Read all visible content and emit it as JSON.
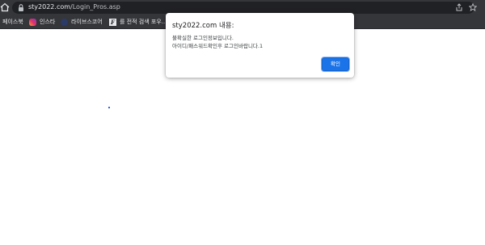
{
  "browser": {
    "url_host": "sty2022.com",
    "url_path": "/Login_Pros.asp",
    "icons": [
      "home-icon",
      "lock-icon",
      "share-icon",
      "star-icon"
    ]
  },
  "bookmarks": {
    "items": [
      {
        "label": "페이스북",
        "icon": null
      },
      {
        "label": "인스타",
        "icon": "instagram-icon"
      },
      {
        "label": "라이브스코어",
        "icon": "livescore-icon"
      },
      {
        "label": "를 전적 검색 포우...",
        "icon": "f-icon"
      }
    ]
  },
  "dialog": {
    "title": "sty2022.com 내용:",
    "message_line1": "불확실한 로그인정보입니다.",
    "message_line2": "아이디/패스워드확인후 로그인바랍니다.1",
    "ok_label": "확인",
    "accent": "#1a73e8"
  }
}
